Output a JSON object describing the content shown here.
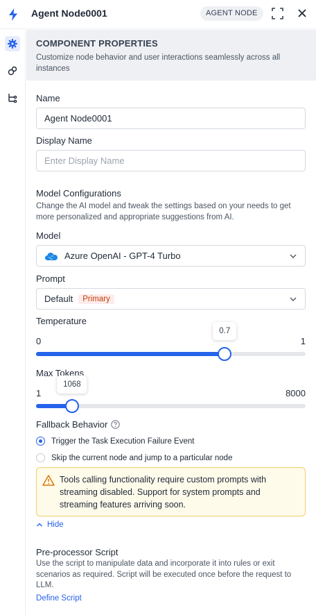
{
  "header": {
    "title": "Agent Node0001",
    "badge": "AGENT NODE"
  },
  "rail": {
    "items": [
      {
        "icon": "gear-icon",
        "active": true
      },
      {
        "icon": "link-nodes-icon",
        "active": false
      },
      {
        "icon": "branch-icon",
        "active": false
      }
    ]
  },
  "section": {
    "heading": "COMPONENT PROPERTIES",
    "description": "Customize node behavior and user interactions seamlessly across all instances"
  },
  "form": {
    "name_label": "Name",
    "name_value": "Agent Node0001",
    "display_name_label": "Display Name",
    "display_name_placeholder": "Enter Display Name",
    "model_config_heading": "Model Configurations",
    "model_config_help": "Change the AI model and tweak the settings based on your needs to get more personalized and appropriate suggestions from AI.",
    "model_label": "Model",
    "model_value": "Azure OpenAI - GPT-4 Turbo",
    "prompt_label": "Prompt",
    "prompt_value": "Default",
    "prompt_badge": "Primary",
    "temperature": {
      "label": "Temperature",
      "min": "0",
      "max": "1",
      "value_text": "0.7",
      "fraction": 0.7
    },
    "max_tokens": {
      "label": "Max Tokens",
      "min": "1",
      "max": "8000",
      "value_text": "1068",
      "fraction": 0.1334
    },
    "fallback_label": "Fallback Behavior",
    "fallback_options": [
      {
        "label": "Trigger the Task Execution Failure Event",
        "selected": true
      },
      {
        "label": "Skip the current node and jump to a particular node",
        "selected": false
      }
    ],
    "warning_text": "Tools calling functionality require custom prompts with streaming disabled. Support for system prompts and streaming features arriving soon.",
    "hide_label": "Hide",
    "preprocessor_heading": "Pre-processor Script",
    "preprocessor_help": "Use the script to manipulate data and incorporate it into rules or exit scenarios as required. Script will be executed once before the request to LLM.",
    "define_script_label": "Define Script"
  },
  "colors": {
    "accent": "#2563eb",
    "warning_bg": "#fffbeb",
    "warning_border": "#f2cf6b",
    "badge_text": "#c2410c"
  }
}
